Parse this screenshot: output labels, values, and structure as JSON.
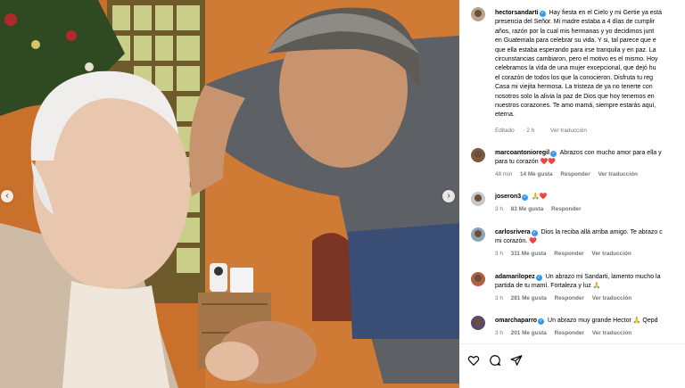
{
  "post": {
    "author": "hectorsandarti",
    "caption_lines": [
      "Hay fiesta en el Cielo y mi Gertie ya está",
      "presencia del Señor. Mi madre estaba a 4 días de cumplir",
      "años, razón por la cual mis hermanas y yo decidimos junt",
      "en Guatemala para celebrar su vida. Y si, tal parece que e",
      "que ella estaba esperando para irse tranquila y en paz. La",
      "circunstancias cambiaron, pero el motivo es el mismo. Hoy",
      "celebramos la vida de una mujer excepcional, que dejó hu",
      "el corazón de todos los que la conocieron. Disfruta tu reg",
      "Casa mi viejita hermosa. La tristeza de ya no tenerte con",
      "nosotros solo la alivia la paz de Dios que hoy tenemos en",
      "nuestros corazones. Te amo mamá, siempre estarás aquí,",
      "eterna."
    ],
    "edited_label": "Editado",
    "time": "2 h",
    "see_translation": "Ver traducción"
  },
  "comments": [
    {
      "user": "marcoantonioregil",
      "text_lines": [
        "Abrazos con mucho amor para ella y",
        "para tu corazón ❤️❤️"
      ],
      "time": "48 min",
      "likes": "14 Me gusta",
      "reply": "Responder",
      "translate": "Ver traducción"
    },
    {
      "user": "joseron3",
      "text_lines": [
        "🙏❤️"
      ],
      "time": "3 h",
      "likes": "83 Me gusta",
      "reply": "Responder",
      "translate": ""
    },
    {
      "user": "carlosrivera",
      "text_lines": [
        "Dios la reciba allá arriba amigo. Te abrazo c",
        "mi corazón. ❤️"
      ],
      "time": "3 h",
      "likes": "311 Me gusta",
      "reply": "Responder",
      "translate": "Ver traducción"
    },
    {
      "user": "adamarilopez",
      "text_lines": [
        "Un abrazo mi Sandarti, lamento mucho la",
        "partida de tu mamí. Fortaleza y luz 🙏"
      ],
      "time": "3 h",
      "likes": "281 Me gusta",
      "reply": "Responder",
      "translate": "Ver traducción"
    },
    {
      "user": "omarchaparro",
      "text_lines": [
        "Un abrazo muy grande Hector 🙏 Qepd"
      ],
      "time": "3 h",
      "likes": "201 Me gusta",
      "reply": "Responder",
      "translate": "Ver traducción"
    }
  ],
  "icons": {
    "like": "heart-outline-icon",
    "comment": "comment-bubble-icon",
    "share": "paper-plane-icon",
    "verified": "verified-badge-icon",
    "prev": "chevron-left-icon",
    "next": "chevron-right-icon"
  },
  "colors": {
    "verified": "#3897f0",
    "meta_text": "#737373"
  }
}
